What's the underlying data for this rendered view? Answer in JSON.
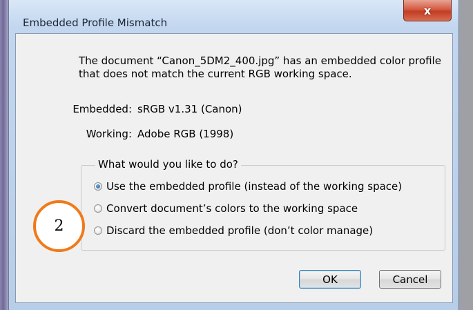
{
  "window": {
    "title": "Embedded Profile Mismatch",
    "close_glyph": "x"
  },
  "message": "The document “Canon_5DM2_400.jpg” has an embedded color profile that does not match the current RGB working space.",
  "profiles": {
    "embedded_label": "Embedded:",
    "embedded_value": "sRGB v1.31 (Canon)",
    "working_label": "Working:",
    "working_value": "Adobe RGB (1998)"
  },
  "options": {
    "caption": "What would you like to do?",
    "items": [
      {
        "label": "Use the embedded profile (instead of the working space)",
        "checked": true
      },
      {
        "label": "Convert document’s colors to the working space",
        "checked": false
      },
      {
        "label": "Discard the embedded profile (don’t color manage)",
        "checked": false
      }
    ]
  },
  "buttons": {
    "ok": "OK",
    "cancel": "Cancel"
  },
  "annotation": {
    "number": "2",
    "color": "#f07a1a"
  },
  "colors": {
    "close_button": "#c23c22",
    "default_button_border": "#3c7fb1"
  }
}
